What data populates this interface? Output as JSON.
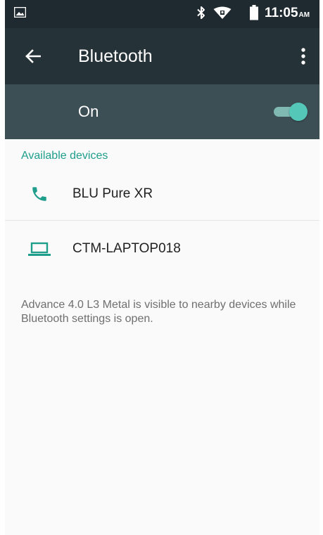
{
  "status_bar": {
    "time": "11:05",
    "ampm": "AM",
    "icons": [
      "image-icon",
      "bluetooth-icon",
      "wifi-icon",
      "battery-icon"
    ]
  },
  "toolbar": {
    "title": "Bluetooth",
    "back_icon": "arrow-back-icon",
    "more_icon": "more-vert-icon"
  },
  "bluetooth_toggle": {
    "label": "On",
    "checked": true
  },
  "available_devices": {
    "header": "Available devices",
    "devices": [
      {
        "name": "BLU Pure XR",
        "icon": "phone-icon"
      },
      {
        "name": "CTM-LAPTOP018",
        "icon": "laptop-icon"
      }
    ]
  },
  "footer": {
    "visibility_text": "Advance 4.0 L3 Metal is visible to nearby devices while Bluetooth settings is open."
  },
  "colors": {
    "status_bar_bg": "#1f2a30",
    "toolbar_bg": "#253238",
    "toggle_bar_bg": "#3c4f54",
    "accent": "#1f9e8c",
    "switch_thumb": "#55c7b8",
    "background": "#fafafa"
  }
}
